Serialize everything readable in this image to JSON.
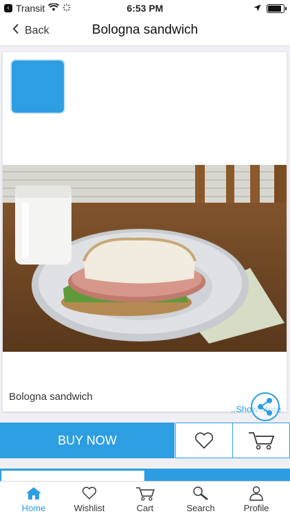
{
  "status_bar": {
    "carrier": "Transit",
    "time": "6:53 PM"
  },
  "nav": {
    "back_label": "Back",
    "title": "Bologna sandwich"
  },
  "product": {
    "name": "Bologna sandwich",
    "show_more_label": "Show More",
    "image_icon": "sandwich-photo"
  },
  "actions": {
    "buy_now_label": "BUY NOW",
    "wishlist_icon": "heart-icon",
    "cart_icon": "cart-icon"
  },
  "tabs": [
    {
      "label": "Home",
      "icon": "home-icon",
      "active": true
    },
    {
      "label": "Wishlist",
      "icon": "heart-icon",
      "active": false
    },
    {
      "label": "Cart",
      "icon": "cart-icon",
      "active": false
    },
    {
      "label": "Search",
      "icon": "search-icon",
      "active": false
    },
    {
      "label": "Profile",
      "icon": "person-icon",
      "active": false
    }
  ],
  "colors": {
    "accent": "#2e9ee2",
    "background": "#efeff4"
  }
}
